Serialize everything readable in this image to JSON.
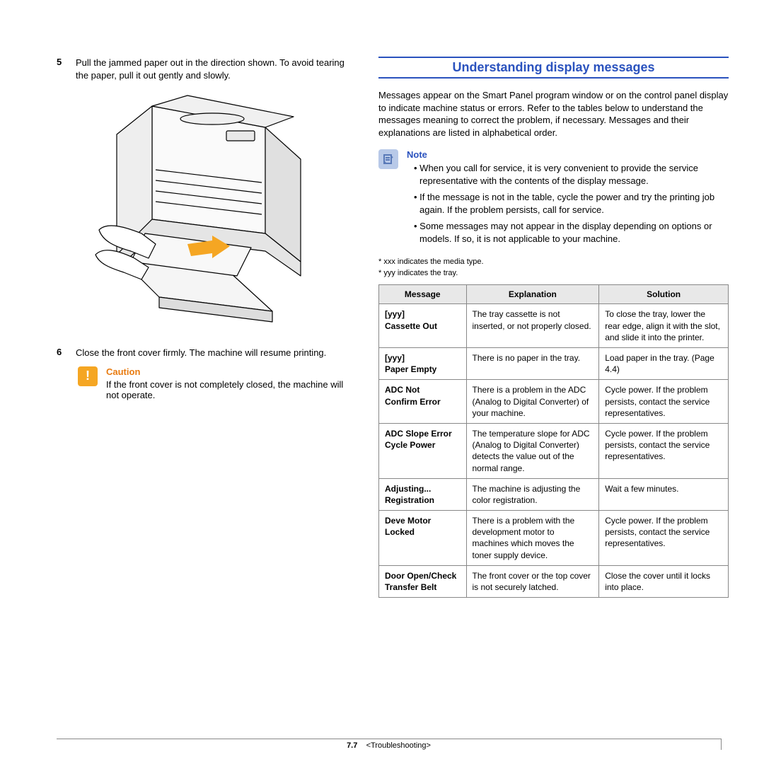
{
  "left": {
    "step5_num": "5",
    "step5_text": "Pull the jammed paper out in the direction shown. To avoid tearing the paper, pull it out gently and slowly.",
    "step6_num": "6",
    "step6_text": "Close the front cover firmly. The machine will resume printing.",
    "caution_title": "Caution",
    "caution_text": "If the front cover is not completely closed, the machine will not operate."
  },
  "right": {
    "section_title": "Understanding display messages",
    "intro": "Messages appear on the Smart Panel program window or on the control panel display to indicate machine status or errors. Refer to the tables below to understand the messages meaning to correct the problem, if necessary. Messages and their explanations are listed in alphabetical order.",
    "note_title": "Note",
    "note_items": [
      "When you call for service, it is very convenient to provide the service representative with the contents of the display message.",
      "If the message is not in the table, cycle the power and try the printing job again. If the problem persists, call for service.",
      "Some messages may not appear in the display depending on options or models. If so, it is not applicable to your machine."
    ],
    "footnote1": "* xxx indicates the media type.",
    "footnote2": "* yyy indicates the tray.",
    "table": {
      "headers": [
        "Message",
        "Explanation",
        "Solution"
      ],
      "rows": [
        {
          "msg": "[yyy]\nCassette Out",
          "exp": "The tray cassette is not inserted, or not properly closed.",
          "sol": "To close the tray, lower the rear edge, align it with the slot, and slide it into the printer."
        },
        {
          "msg": "[yyy]\nPaper Empty",
          "exp": "There is no paper in the tray.",
          "sol": "Load paper in the tray. (Page 4.4)"
        },
        {
          "msg": "ADC Not\nConfirm Error",
          "exp": "There is a problem in the ADC (Analog to Digital Converter) of your machine.",
          "sol": "Cycle power. If the problem persists, contact the service representatives."
        },
        {
          "msg": "ADC Slope Error\nCycle Power",
          "exp": "The temperature slope for ADC (Analog to Digital Converter) detects the value out of the normal range.",
          "sol": "Cycle power. If the problem persists, contact the service representatives."
        },
        {
          "msg": "Adjusting...\nRegistration",
          "exp": "The machine is adjusting the color registration.",
          "sol": "Wait a few minutes."
        },
        {
          "msg": "Deve Motor\nLocked",
          "exp": "There is a problem with the development motor to machines which moves the toner supply device.",
          "sol": "Cycle power. If the problem persists, contact the service representatives."
        },
        {
          "msg": "Door Open/Check\nTransfer Belt",
          "exp": "The front cover or the top cover is not securely latched.",
          "sol": "Close the cover until it locks into place."
        }
      ]
    }
  },
  "footer": {
    "pagenum": "7.7",
    "section": "<Troubleshooting>"
  }
}
